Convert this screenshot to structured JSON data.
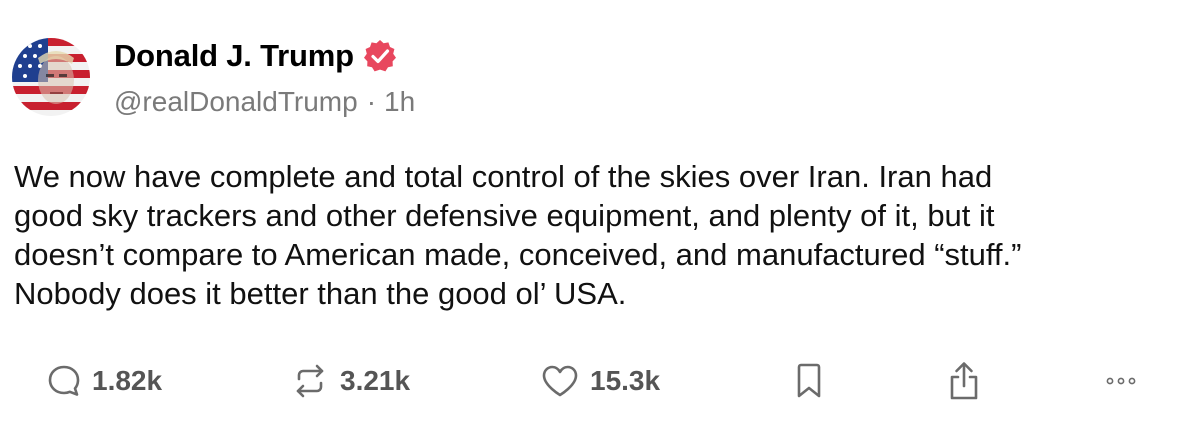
{
  "post": {
    "author": {
      "display_name": "Donald J. Trump",
      "verified": true,
      "handle": "@realDonaldTrump",
      "separator": "·",
      "time": "1h",
      "avatar_icon": "flag-portrait-avatar"
    },
    "body_lines": [
      "We now have complete and total control of the skies over Iran. Iran had",
      "good sky trackers and other defensive equipment, and plenty of it, but it",
      "doesn’t compare to American made, conceived, and manufactured “stuff.”",
      "Nobody does it better than the good ol’ USA."
    ],
    "actions": {
      "replies": {
        "icon": "reply-icon",
        "count": "1.82k"
      },
      "retruths": {
        "icon": "repost-icon",
        "count": "3.21k"
      },
      "likes": {
        "icon": "heart-icon",
        "count": "15.3k"
      },
      "bookmark": {
        "icon": "bookmark-icon"
      },
      "share": {
        "icon": "share-icon"
      },
      "more": {
        "icon": "more-icon"
      }
    }
  },
  "colors": {
    "verified_badge": "#e8475e",
    "secondary_text": "#7a7a7a",
    "action_icon": "#6b6b6b"
  }
}
